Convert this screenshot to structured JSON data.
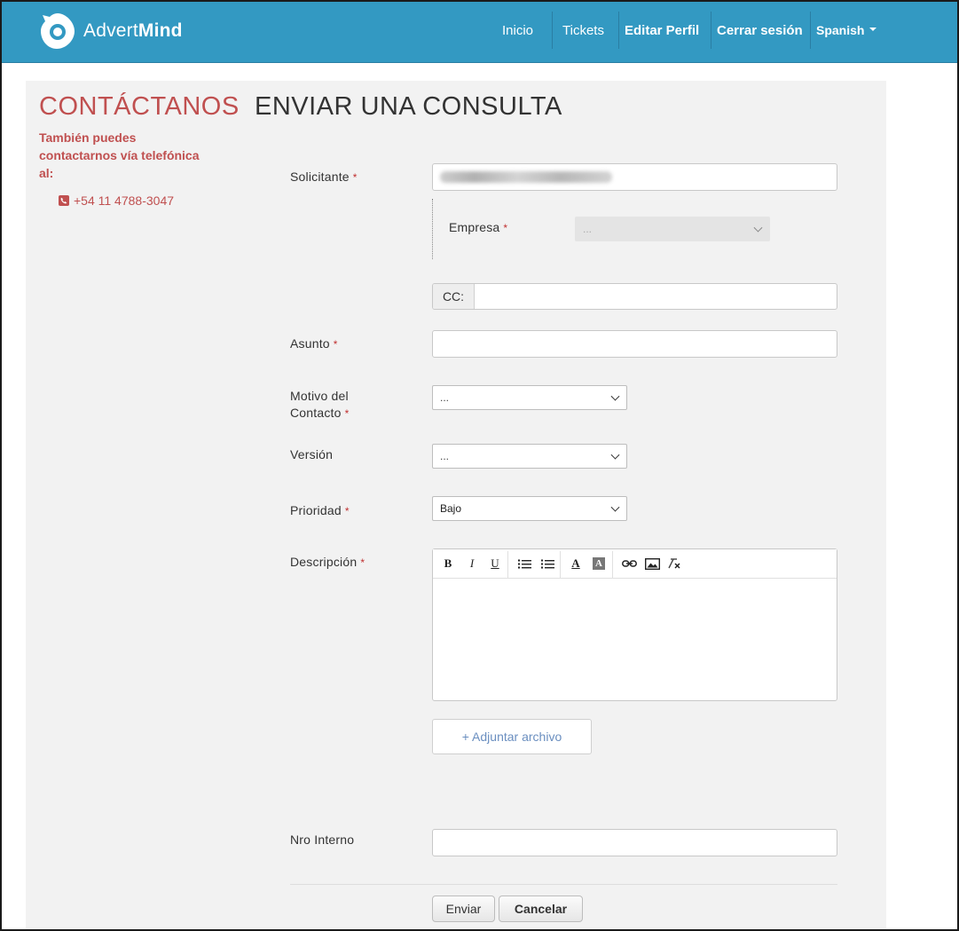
{
  "header": {
    "brand_light": "Advert",
    "brand_bold": "Mind",
    "nav": {
      "inicio": "Inicio",
      "tickets": "Tickets",
      "editar_perfil": "Editar Perfil",
      "cerrar_sesion": "Cerrar sesión",
      "language": "Spanish"
    },
    "bar_color": "#3399c2"
  },
  "page": {
    "title": "CONTÁCTANOS",
    "subtitle": "ENVIAR UNA CONSULTA",
    "side_note": "También puedes contactarnos vía telefónica al:",
    "phone": "+54 11 4788-3047",
    "accent_color": "#c05050"
  },
  "form": {
    "solicitante_label": "Solicitante",
    "empresa_label": "Empresa",
    "empresa_value": "...",
    "cc_label": "CC:",
    "asunto_label": "Asunto",
    "motivo_label_line1": "Motivo del",
    "motivo_label_line2": "Contacto",
    "motivo_value": "...",
    "version_label": "Versión",
    "version_value": "...",
    "prioridad_label": "Prioridad",
    "prioridad_value": "Bajo",
    "descripcion_label": "Descripción",
    "attach_label": "+ Adjuntar archivo",
    "nro_interno_label": "Nro Interno",
    "required_mark": "*"
  },
  "editor_toolbar": [
    "bold-icon",
    "italic-icon",
    "underline-icon",
    "bulleted-list-icon",
    "numbered-list-icon",
    "text-color-icon",
    "background-color-icon",
    "link-icon",
    "image-icon",
    "remove-format-icon"
  ],
  "actions": {
    "submit": "Enviar",
    "cancel": "Cancelar"
  }
}
